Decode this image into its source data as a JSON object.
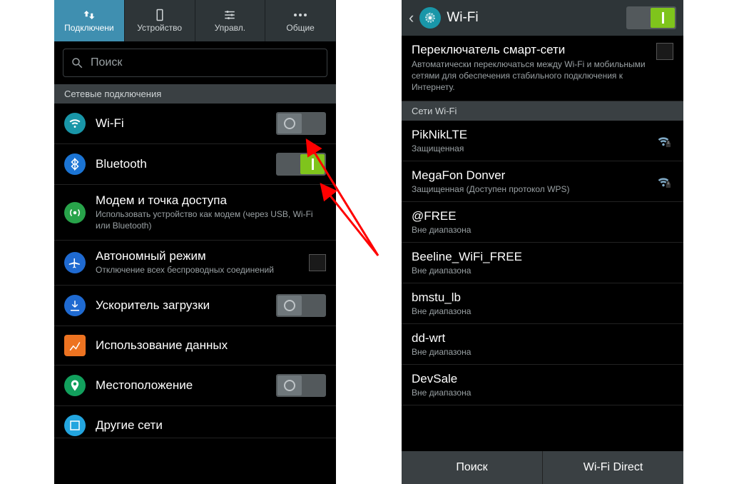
{
  "left": {
    "tabs": [
      {
        "label": "Подключени"
      },
      {
        "label": "Устройство"
      },
      {
        "label": "Управл."
      },
      {
        "label": "Общие"
      }
    ],
    "search": {
      "placeholder": "Поиск"
    },
    "section": "Сетевые подключения",
    "items": {
      "wifi": {
        "title": "Wi-Fi"
      },
      "bluetooth": {
        "title": "Bluetooth"
      },
      "tether": {
        "title": "Модем и точка доступа",
        "sub": "Использовать устройство как модем (через USB, Wi-Fi или Bluetooth)"
      },
      "airplane": {
        "title": "Автономный режим",
        "sub": "Отключение всех беспроводных соединений"
      },
      "booster": {
        "title": "Ускоритель загрузки"
      },
      "datausage": {
        "title": "Использование данных"
      },
      "location": {
        "title": "Местоположение"
      },
      "more": {
        "title": "Другие сети"
      }
    }
  },
  "right": {
    "title": "Wi-Fi",
    "smart": {
      "title": "Переключатель смарт-сети",
      "sub": "Автоматически переключаться между Wi-Fi и мобильными сетями для обеспечения стабильного подключения к Интернету."
    },
    "section": "Сети Wi-Fi",
    "networks": [
      {
        "name": "PikNikLTE",
        "sub": "Защищенная",
        "signal": true
      },
      {
        "name": "MegaFon Donver",
        "sub": "Защищенная (Доступен протокол WPS)",
        "signal": true
      },
      {
        "name": "@FREE",
        "sub": "Вне диапазона",
        "signal": false
      },
      {
        "name": "Beeline_WiFi_FREE",
        "sub": "Вне диапазона",
        "signal": false
      },
      {
        "name": "bmstu_lb",
        "sub": "Вне диапазона",
        "signal": false
      },
      {
        "name": "dd-wrt",
        "sub": "Вне диапазона",
        "signal": false
      },
      {
        "name": "DevSale",
        "sub": "Вне диапазона",
        "signal": false
      }
    ],
    "footer": {
      "search": "Поиск",
      "direct": "Wi-Fi Direct"
    }
  }
}
